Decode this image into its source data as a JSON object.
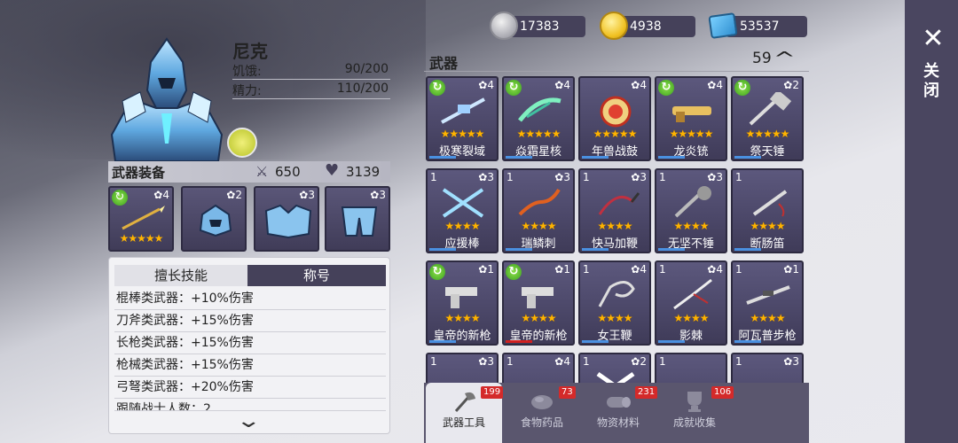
{
  "currency": {
    "silver": "17383",
    "gold": "4938",
    "ticket": "53537"
  },
  "close": {
    "label": "关闭",
    "icon": "close-icon"
  },
  "character": {
    "name": "尼克",
    "hunger_label": "饥饿:",
    "hunger_value": "90/200",
    "energy_label": "精力:",
    "energy_value": "110/200"
  },
  "equipment": {
    "title": "武器装备",
    "attack": "650",
    "health": "3139",
    "slots": [
      {
        "level": "4",
        "stars": "★★★★★",
        "refresh": true
      },
      {
        "level": "2"
      },
      {
        "level": "3"
      },
      {
        "level": "3"
      }
    ]
  },
  "skills": {
    "tab_skills": "擅长技能",
    "tab_titles": "称号",
    "lines": [
      "棍棒类武器：+10%伤害",
      "刀斧类武器：+15%伤害",
      "长枪类武器：+15%伤害",
      "枪械类武器：+15%伤害",
      "弓弩类武器：+20%伤害",
      "跟随战士人数：2"
    ]
  },
  "weapons": {
    "title": "武器",
    "count": "59",
    "items": [
      {
        "name": "极寒裂域",
        "level": "4",
        "stars": "★★★★★",
        "refresh": true,
        "qty": ""
      },
      {
        "name": "焱霜星核",
        "level": "4",
        "stars": "★★★★★",
        "refresh": true,
        "qty": ""
      },
      {
        "name": "年兽战鼓",
        "level": "4",
        "stars": "★★★★★",
        "refresh": false,
        "qty": ""
      },
      {
        "name": "龙炎铳",
        "level": "4",
        "stars": "★★★★★",
        "refresh": true,
        "qty": ""
      },
      {
        "name": "祭天锤",
        "level": "2",
        "stars": "★★★★★",
        "refresh": true,
        "qty": ""
      },
      {
        "name": "应援棒",
        "level": "3",
        "stars": "★★★★",
        "refresh": false,
        "qty": "1"
      },
      {
        "name": "瑞鳞刺",
        "level": "3",
        "stars": "★★★★",
        "refresh": false,
        "qty": "1"
      },
      {
        "name": "快马加鞭",
        "level": "3",
        "stars": "★★★★",
        "refresh": false,
        "qty": "1"
      },
      {
        "name": "无坚不锤",
        "level": "3",
        "stars": "★★★★",
        "refresh": false,
        "qty": "1"
      },
      {
        "name": "断肠笛",
        "level": "",
        "stars": "★★★★",
        "refresh": false,
        "qty": "1"
      },
      {
        "name": "皇帝的新枪",
        "level": "1",
        "stars": "★★★★",
        "refresh": true,
        "qty": ""
      },
      {
        "name": "皇帝的新枪",
        "level": "1",
        "stars": "★★★★",
        "refresh": true,
        "qty": ""
      },
      {
        "name": "女王鞭",
        "level": "4",
        "stars": "★★★★",
        "refresh": false,
        "qty": "1"
      },
      {
        "name": "影棘",
        "level": "4",
        "stars": "★★★★",
        "refresh": false,
        "qty": "1"
      },
      {
        "name": "阿瓦普步枪",
        "level": "1",
        "stars": "★★★★",
        "refresh": false,
        "qty": "1"
      },
      {
        "name": "",
        "level": "3",
        "stars": "",
        "refresh": false,
        "qty": "1"
      },
      {
        "name": "",
        "level": "4",
        "stars": "",
        "refresh": false,
        "qty": "1"
      },
      {
        "name": "",
        "level": "2",
        "stars": "",
        "refresh": false,
        "qty": "1"
      },
      {
        "name": "",
        "level": "",
        "stars": "",
        "refresh": false,
        "qty": "1"
      },
      {
        "name": "",
        "level": "3",
        "stars": "",
        "refresh": false,
        "qty": "1"
      }
    ]
  },
  "bottom_tabs": [
    {
      "label": "武器工具",
      "count": "199"
    },
    {
      "label": "食物药品",
      "count": "73"
    },
    {
      "label": "物资材料",
      "count": "231"
    },
    {
      "label": "成就收集",
      "count": "106"
    }
  ],
  "colors": {
    "card_bg": "#4b4768",
    "panel_dark": "#45415a",
    "star": "#ffb400",
    "refresh": "#3aa020",
    "count_badge": "#d42a2a"
  }
}
